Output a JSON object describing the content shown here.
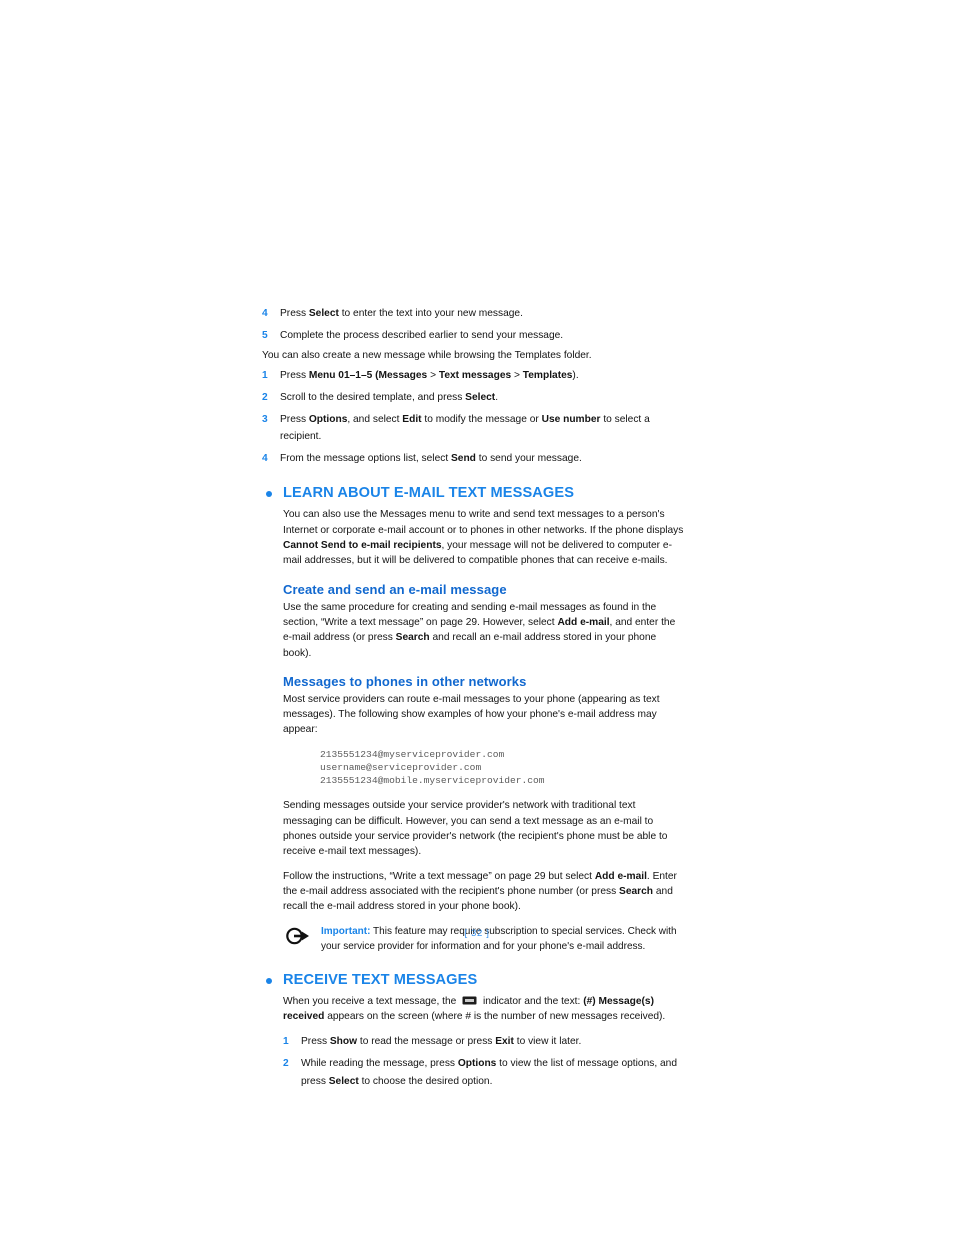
{
  "document": {
    "page_number": "[ 32 ]",
    "colors": {
      "heading_blue": "#1a84e8",
      "subheading_blue": "#1168cf",
      "body_text": "#141414",
      "code_gray": "#5b5b5b",
      "page_number_blue": "#3d94ef"
    }
  },
  "top_steps_a": [
    {
      "num": "4",
      "text_before": "Press ",
      "bold1": "Select",
      "text_after": " to enter the text into your new message."
    },
    {
      "num": "5",
      "text_before": "Complete the process described earlier to send your message.",
      "bold1": "",
      "text_after": ""
    }
  ],
  "templates_intro": "You can also create a new message while browsing the Templates folder.",
  "top_steps_b": [
    {
      "num": "1",
      "p1": "Press ",
      "b1": "Menu 01–1–5 (Messages",
      "p2": " > ",
      "b2": "Text messages",
      "p3": " > ",
      "b3": "Templates",
      "p4": ")."
    },
    {
      "num": "2",
      "p1": "Scroll to the desired template, and press ",
      "b1": "Select",
      "p2": ".",
      "b2": "",
      "p3": "",
      "b3": "",
      "p4": ""
    },
    {
      "num": "3",
      "p1": "Press ",
      "b1": "Options",
      "p2": ", and select ",
      "b2": "Edit",
      "p3": " to modify the message or ",
      "b3": "Use number",
      "p4": " to select a recipient."
    },
    {
      "num": "4",
      "p1": "From the message options list, select ",
      "b1": "Send",
      "p2": " to send your message.",
      "b2": "",
      "p3": "",
      "b3": "",
      "p4": ""
    }
  ],
  "section_learn": {
    "title": "LEARN ABOUT E-MAIL TEXT MESSAGES",
    "para1_a": "You can also use the Messages menu to write and send text messages to a person's Internet or corporate e-mail account or to phones in other networks. If the phone displays ",
    "para1_bold": "Cannot Send to e-mail recipients",
    "para1_b": ", your message will not be delivered to computer e-mail addresses, but it will be delivered to compatible phones that can receive e-mails.",
    "sub1_title": "Create and send an e-mail message",
    "sub1_para_a": "Use the same procedure for creating and sending e-mail messages as found in the section, “Write a text message” on page 29. However, select ",
    "sub1_bold1": "Add e-mail",
    "sub1_para_b": ", and enter the e-mail address (or press ",
    "sub1_bold2": "Search",
    "sub1_para_c": " and recall an e-mail address stored in your phone book).",
    "sub2_title": "Messages to phones in other networks",
    "sub2_para": "Most service providers can route e-mail messages to your phone (appearing as text messages). The following show examples of how your phone's e-mail address may appear:",
    "code_lines": [
      "2135551234@myserviceprovider.com",
      "username@serviceprovider.com",
      "2135551234@mobile.myserviceprovider.com"
    ],
    "sub2_para2": "Sending messages outside your service provider's network with traditional text messaging can be difficult. However, you can send a text message as an e-mail to phones outside your service provider's network (the recipient's phone must be able to receive e-mail text messages).",
    "sub2_para3_a": "Follow the instructions, “Write a text message” on page 29 but select ",
    "sub2_para3_bold1": "Add e-mail",
    "sub2_para3_b": ". Enter the e-mail address associated with the recipient's phone number (or press ",
    "sub2_para3_bold2": "Search",
    "sub2_para3_c": " and recall the e-mail address stored in your phone book).",
    "note_label": "Important:",
    "note_text": " This feature may require subscription to special services. Check with your service provider for information and for your phone's e-mail address."
  },
  "section_receive": {
    "title": "RECEIVE TEXT MESSAGES",
    "intro_a": "When you receive a text message, the ",
    "intro_b": " indicator and the text: ",
    "intro_bold": "(#) Message(s) received",
    "intro_c": " appears on the screen (where # is the number of new messages received).",
    "steps": [
      {
        "num": "1",
        "p1": "Press ",
        "b1": "Show",
        "p2": " to read the message or press ",
        "b2": "Exit",
        "p3": " to view it later.",
        "b3": "",
        "p4": ""
      },
      {
        "num": "2",
        "p1": "While reading the message, press ",
        "b1": "Options",
        "p2": " to view the list of message options, and press ",
        "b2": "Select",
        "p3": " to choose the desired option.",
        "b3": "",
        "p4": ""
      }
    ]
  }
}
